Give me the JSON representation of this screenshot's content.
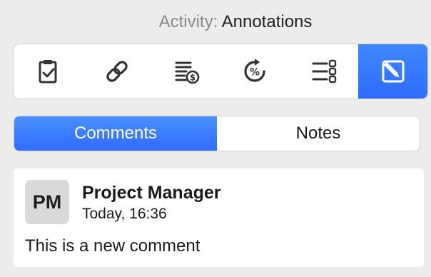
{
  "header": {
    "label": "Activity:",
    "value": "Annotations"
  },
  "toolbar": {
    "icons": [
      "clipboard-check-icon",
      "link-icon",
      "cost-list-icon",
      "percent-refresh-icon",
      "checklist-icon",
      "pencil-edit-icon"
    ],
    "active_index": 5,
    "accent_color": "#2f6cff"
  },
  "segmented": {
    "tabs": [
      "Comments",
      "Notes"
    ],
    "selected": "Comments"
  },
  "comment": {
    "avatar_initials": "PM",
    "author": "Project Manager",
    "timestamp": "Today, 16:36",
    "text": "This is a new comment"
  }
}
